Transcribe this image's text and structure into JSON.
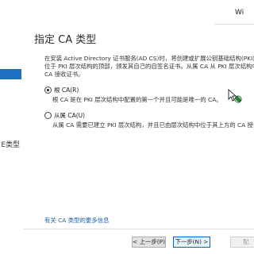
{
  "window": {
    "title_fragment": "Wi"
  },
  "nav": {
    "items": [
      {
        "label": "",
        "selected": true
      },
      {
        "label": "E类型",
        "selected": false
      }
    ]
  },
  "page": {
    "title": "指定 CA 类型",
    "intro_lines": [
      "在安装 Active Directory 证书服务(AD CS)时，将创建或扩展公钥基础结构(PKI)层",
      "位于 PKI 层次结构的顶部，颁发其自己的自签名证书。从属 CA 从 PKI 层次结构中",
      "CA 接收证书。"
    ]
  },
  "options": {
    "root": {
      "label": "根 CA(R)",
      "checked": true,
      "description": "根 CA 是在 PKI 层次结构中配置的第一个并且可能是唯一的 CA。"
    },
    "subordinate": {
      "label": "从属 CA(U)",
      "checked": false,
      "description": "从属 CA 需要已建立 PKI 层次结构，并且已由层次结构中位于其上方的 CA 授"
    }
  },
  "links": {
    "more_info": "有关 CA 类型的更多信息"
  },
  "buttons": {
    "back": "< 上一步(P)",
    "next": "下一步(N) >",
    "configure": "配"
  },
  "icons": {
    "cursor": "busy-pointer-icon"
  }
}
